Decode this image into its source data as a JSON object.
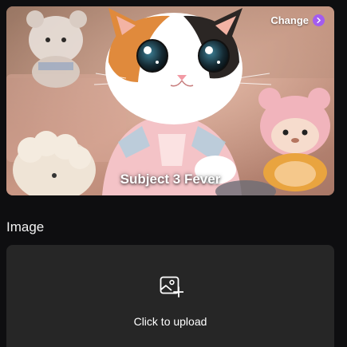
{
  "template_card": {
    "title": "Subject 3 Fever",
    "change_label": "Change",
    "accent_color": "#a35cf0"
  },
  "image_section": {
    "label": "Image",
    "upload_prompt": "Click to upload",
    "upload_icon": "image-add-icon",
    "background_color": "#262626"
  }
}
